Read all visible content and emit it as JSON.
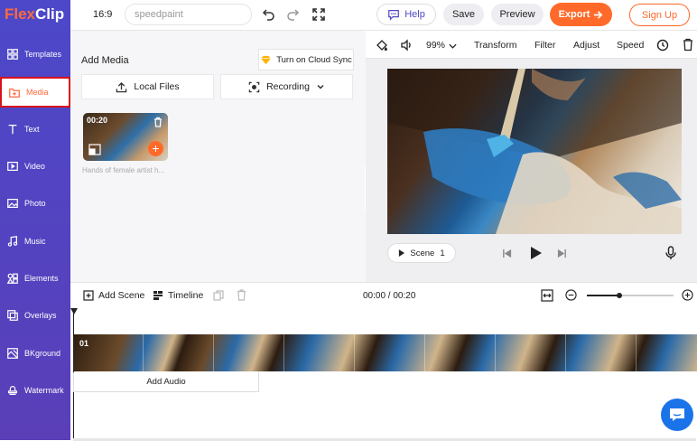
{
  "app": {
    "logo_flex": "Flex",
    "logo_clip": "Clip"
  },
  "sidebar": {
    "items": [
      {
        "label": "Templates",
        "icon": "templates-icon"
      },
      {
        "label": "Media",
        "icon": "media-icon",
        "active": true
      },
      {
        "label": "Text",
        "icon": "text-icon"
      },
      {
        "label": "Video",
        "icon": "video-icon"
      },
      {
        "label": "Photo",
        "icon": "photo-icon"
      },
      {
        "label": "Music",
        "icon": "music-icon"
      },
      {
        "label": "Elements",
        "icon": "elements-icon"
      },
      {
        "label": "Overlays",
        "icon": "overlays-icon"
      },
      {
        "label": "BKground",
        "icon": "background-icon"
      },
      {
        "label": "Watermark",
        "icon": "watermark-icon"
      }
    ]
  },
  "topbar": {
    "ratio": "16:9",
    "project_name": "speedpaint",
    "help_label": "Help",
    "save_label": "Save",
    "preview_label": "Preview",
    "export_label": "Export",
    "signup_label": "Sign Up"
  },
  "media_panel": {
    "title": "Add Media",
    "cloud_sync_label": "Turn on Cloud Sync",
    "local_files_label": "Local Files",
    "recording_label": "Recording",
    "clip": {
      "duration": "00:20",
      "caption": "Hands of female artist h..."
    }
  },
  "preview": {
    "zoom": "99%",
    "tools": [
      "Transform",
      "Filter",
      "Adjust",
      "Speed"
    ],
    "scene_label": "Scene",
    "scene_number": "1"
  },
  "timeline": {
    "add_scene_label": "Add Scene",
    "timeline_label": "Timeline",
    "time_display": "00:00 / 00:20",
    "clip_number": "01",
    "add_audio_label": "Add Audio",
    "zoom_level": 0.37
  },
  "colors": {
    "accent": "#ff6a2a",
    "sidebar": "#4c48c9",
    "brand_text": "#5049c7"
  }
}
